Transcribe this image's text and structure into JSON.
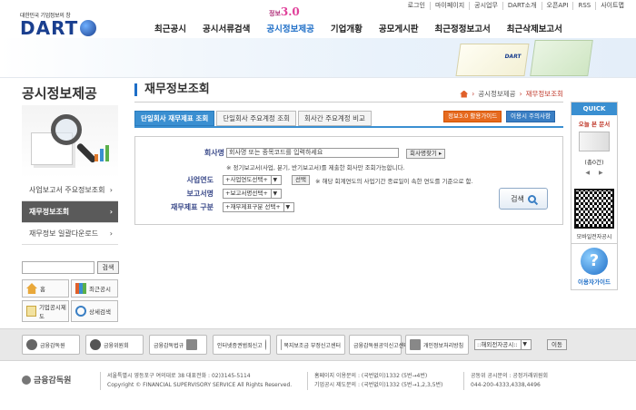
{
  "util_links": [
    "로그인",
    "마이페이지",
    "공시업무",
    "DART소개",
    "오픈API",
    "RSS",
    "사이트맵"
  ],
  "logo": {
    "sub": "대한민국 기업정보의 창",
    "main": "DART"
  },
  "badge": {
    "prefix": "정보",
    "version": "3.0"
  },
  "gnb": [
    "최근공시",
    "공시서류검색",
    "공시정보제공",
    "기업개황",
    "공모게시판",
    "최근정정보고서",
    "최근삭제보고서"
  ],
  "gnb_active_index": 2,
  "banner_book_label": "DART",
  "sidebar": {
    "title": "공시정보제공",
    "items": [
      {
        "label": "사업보고서 주요정보조회",
        "arrow": "›"
      },
      {
        "label": "재무정보조회",
        "arrow": "›"
      },
      {
        "label": "재무정보 일괄다운로드",
        "arrow": "›"
      }
    ],
    "active_index": 1,
    "search_button": "검색",
    "quick_buttons": [
      "홈",
      "최근공시",
      "기업공시제도",
      "상세검색"
    ]
  },
  "main": {
    "title": "재무정보조회",
    "breadcrumb": [
      "공시정보제공",
      "재무정보조회"
    ],
    "tabs": [
      "단일회사 재무제표 조회",
      "단일회사 주요계정 조회",
      "회사간 주요계정 비교"
    ],
    "active_tab": 0,
    "guide_buttons": [
      "정보3.0 활용가이드",
      "이용시 주의사항"
    ],
    "form": {
      "company_label": "회사명",
      "company_placeholder": "회사명 또는 종목코드를 입력하세요",
      "company_search_button": "회사명찾기 ▸",
      "company_note": "※ 정기보고서(사업, 분기, 반기보고서)를 제출한 회사만 조회가능합니다.",
      "year_label": "사업연도",
      "year_select": "+사업연도선택+",
      "year_button": "선택",
      "year_note": "※ 해당 회계연도의 사업기간 종료일이 속한 연도를 기준으로 함.",
      "report_label": "보고서명",
      "report_select": "+보고서명선택+",
      "fs_label": "재무제표 구분",
      "fs_select": "+재무제표구분 선택+",
      "search_button": "검색"
    }
  },
  "quick_panel": {
    "header": "QUICK",
    "today": "오늘 본 문서",
    "count": "(총0건)",
    "prev": "◀",
    "next": "▶",
    "qr_label": "모바일전자공시",
    "help_label": "이용자가이드",
    "help_glyph": "?"
  },
  "footer_banners": [
    {
      "label": "금융감독원"
    },
    {
      "label": "금융위원회"
    },
    {
      "label": "금융감독법규"
    },
    {
      "label": "인터넷증권범죄신고"
    },
    {
      "label": "복지보조금 부정신고센터"
    },
    {
      "label": "금융감독원공익신고센터"
    },
    {
      "label": "개인정보처리방침"
    }
  ],
  "footer_select": "::해외전자공시::",
  "footer_go": "이동",
  "footer": {
    "logo": "금융감독원",
    "address": "서울특별시 영등포구 여의대로 38     대표전화 : 02)3145-5114",
    "copyright": "Copyright © FINANCIAL SUPERVISORY SERVICE All Rights Reserved.",
    "contact1": "홈페이지 이용문의 : (국번없이)1332 (5번→4번)",
    "contact2": "기업공시 제도문의 : (국번없이)1332 (5번→1,2,3,5번)",
    "contact3": "공동위 공시문의 : 공정거래위원회",
    "contact4": "044-200-4333,4338,4496"
  },
  "colors": {
    "brand": "#1a3f8f",
    "accent": "#3a8fd1",
    "orange": "#e66a1e"
  }
}
